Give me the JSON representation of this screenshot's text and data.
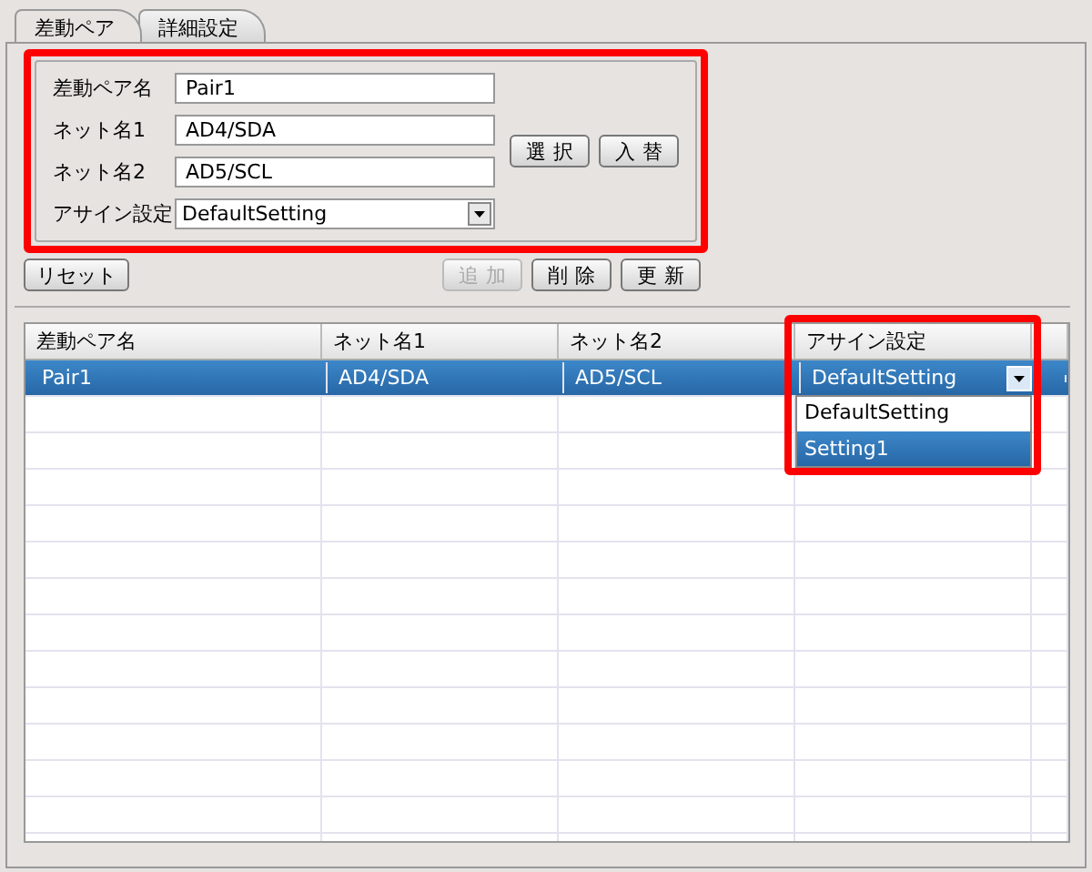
{
  "tabs": [
    {
      "label": "差動ペア",
      "selected": true
    },
    {
      "label": "詳細設定",
      "selected": false
    }
  ],
  "form": {
    "fields": [
      {
        "label": "差動ペア名",
        "value": "Pair1",
        "kind": "text"
      },
      {
        "label": "ネット名1",
        "value": "AD4/SDA",
        "kind": "text"
      },
      {
        "label": "ネット名2",
        "value": "AD5/SCL",
        "kind": "text"
      },
      {
        "label": "アサイン設定",
        "value": "DefaultSetting",
        "kind": "select"
      }
    ],
    "buttons": [
      {
        "label": "選択",
        "disabled": false
      },
      {
        "label": "入替",
        "disabled": false
      }
    ]
  },
  "actions": {
    "reset": {
      "label": "リセット",
      "disabled": false
    },
    "buttons": [
      {
        "label": "追加",
        "disabled": true
      },
      {
        "label": "削除",
        "disabled": false
      },
      {
        "label": "更新",
        "disabled": false
      }
    ]
  },
  "table": {
    "columns": [
      "差動ペア名",
      "ネット名1",
      "ネット名2",
      "アサイン設定"
    ],
    "rows": [
      {
        "cells": [
          "Pair1",
          "AD4/SDA",
          "AD5/SCL",
          "DefaultSetting"
        ],
        "selected": true
      }
    ],
    "dropdown": {
      "options": [
        {
          "label": "DefaultSetting",
          "selected": false
        },
        {
          "label": "Setting1",
          "selected": true
        }
      ]
    }
  }
}
